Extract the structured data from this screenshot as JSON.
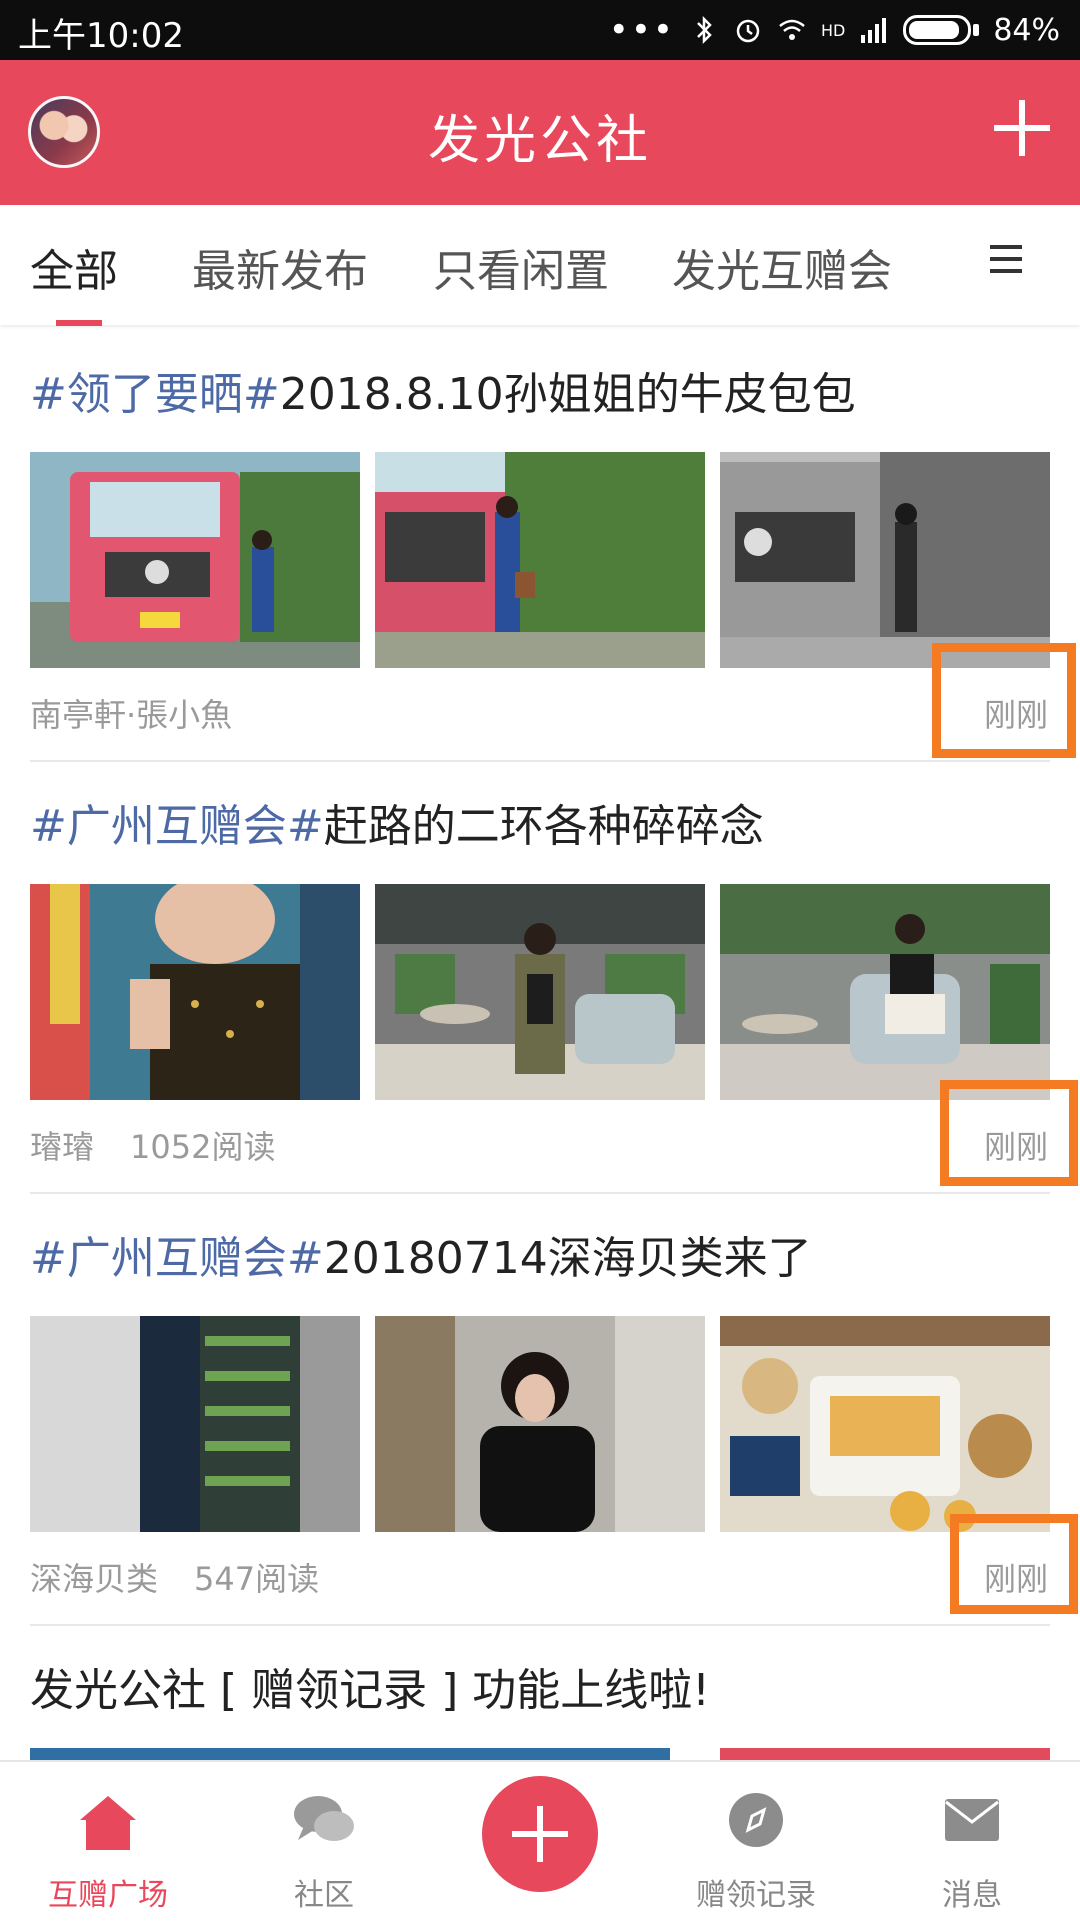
{
  "status_bar": {
    "time": "上午10:02",
    "battery": "84%",
    "signal_label": "HD"
  },
  "header": {
    "title": "发光公社"
  },
  "tabs": [
    {
      "label": "全部",
      "active": true
    },
    {
      "label": "最新发布"
    },
    {
      "label": "只看闲置"
    },
    {
      "label": "发光互赠会"
    }
  ],
  "posts": [
    {
      "tag": "#领了要晒#",
      "title": "2018.8.10孙姐姐的牛皮包包",
      "author": "南亭軒·張小魚",
      "reads": "",
      "time": "刚刚"
    },
    {
      "tag": "#广州互赠会#",
      "title": "赶路的二环各种碎碎念",
      "author": "璿璿",
      "reads": "1052阅读",
      "time": "刚刚"
    },
    {
      "tag": "#广州互赠会#",
      "title": "20180714深海贝类来了",
      "author": "深海贝类",
      "reads": "547阅读",
      "time": "刚刚"
    },
    {
      "tag": "",
      "title": "发光公社 [ 赠领记录 ] 功能上线啦!",
      "author": "",
      "reads": "",
      "time": ""
    }
  ],
  "bottom_nav": [
    {
      "label": "互赠广场",
      "icon": "home-icon",
      "active": true
    },
    {
      "label": "社区",
      "icon": "chat-bubble-icon"
    },
    {
      "label": "",
      "icon": "plus-icon"
    },
    {
      "label": "赠领记录",
      "icon": "compass-icon"
    },
    {
      "label": "消息",
      "icon": "mail-icon"
    }
  ],
  "colors": {
    "accent": "#e8485b",
    "tag_blue": "#4d6aa6",
    "highlight_orange": "#f47b22"
  }
}
